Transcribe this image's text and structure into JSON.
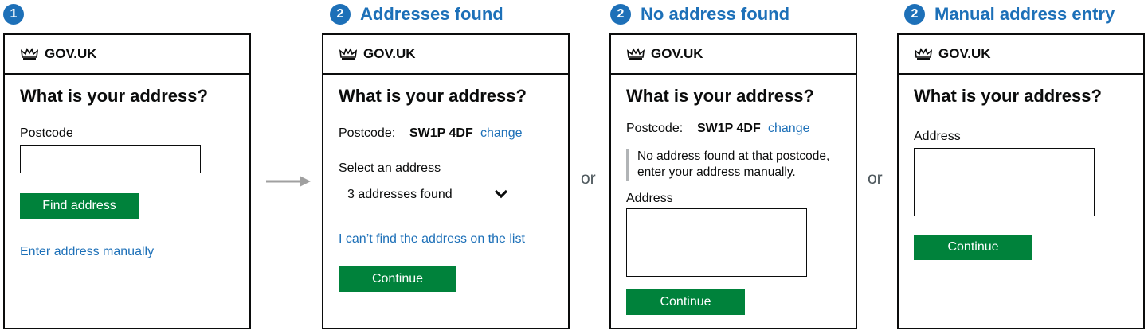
{
  "steps": [
    {
      "number": "1",
      "title": ""
    },
    {
      "number": "2",
      "title": "Addresses found"
    },
    {
      "number": "2",
      "title": "No address found"
    },
    {
      "number": "2",
      "title": "Manual address entry"
    }
  ],
  "header": {
    "brand": "GOV.UK",
    "icon": "crown-icon"
  },
  "question": "What is your address?",
  "panel1": {
    "postcode_label": "Postcode",
    "find_button": "Find address",
    "manual_link": "Enter address manually"
  },
  "panel2": {
    "postcode_label": "Postcode:",
    "postcode_value": "SW1P 4DF",
    "change_link": "change",
    "select_label": "Select an address",
    "select_value": "3 addresses found",
    "cant_find_link": "I can’t find the address on the list",
    "continue_button": "Continue"
  },
  "panel3": {
    "postcode_label": "Postcode:",
    "postcode_value": "SW1P 4DF",
    "change_link": "change",
    "inset_line1": "No address found at that postcode,",
    "inset_line2": "enter your address manually.",
    "address_label": "Address",
    "continue_button": "Continue"
  },
  "panel4": {
    "address_label": "Address",
    "continue_button": "Continue"
  },
  "connectors": {
    "or_1": "or",
    "or_2": "or"
  },
  "colors": {
    "link_blue": "#1d70b8",
    "button_green": "#00823b",
    "text": "#0b0c0c",
    "inset_border": "#b1b4b6"
  }
}
